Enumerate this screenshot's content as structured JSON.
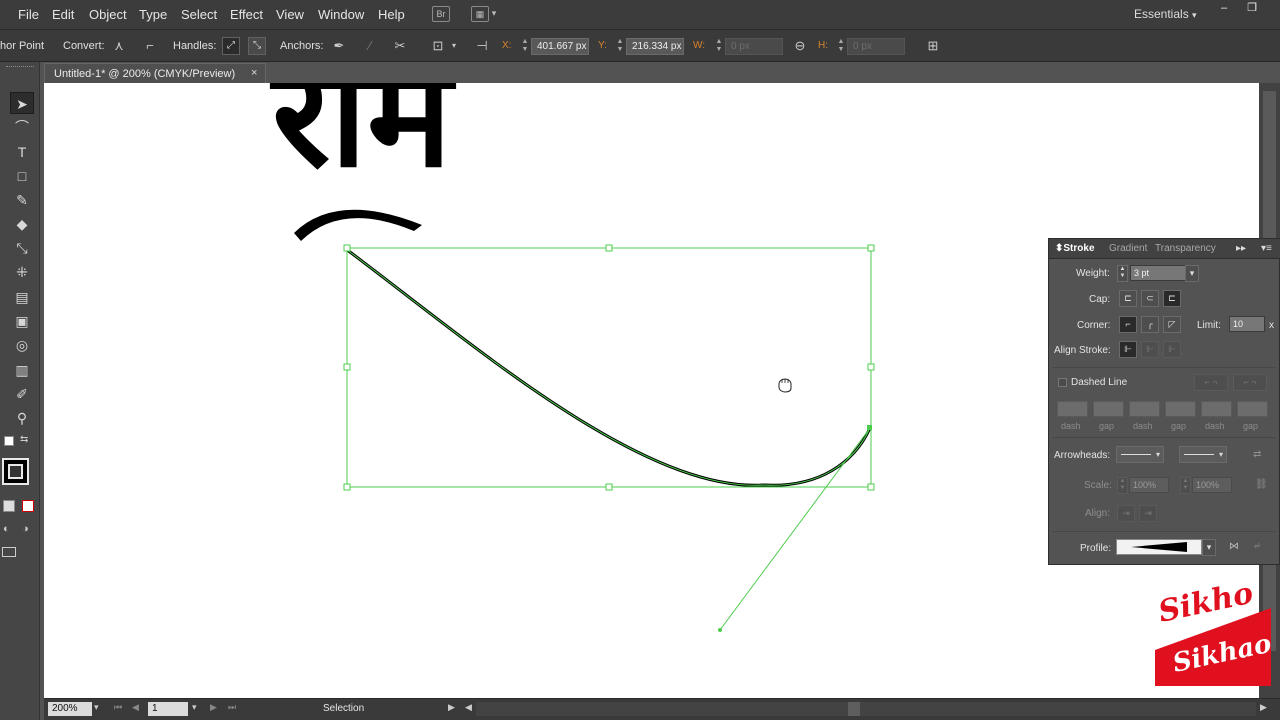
{
  "menubar": {
    "items": [
      "File",
      "Edit",
      "Object",
      "Type",
      "Select",
      "Effect",
      "View",
      "Window",
      "Help"
    ],
    "bridge_icon": "Br",
    "arrange_icon": "arrange-documents-icon",
    "workspace": "Essentials",
    "window_controls": [
      "–",
      "❐"
    ]
  },
  "controlbar": {
    "tool_name": "hor Point",
    "convert_label": "Convert:",
    "handles_label": "Handles:",
    "anchors_label": "Anchors:",
    "x_label": "X:",
    "x_value": "401.667 px",
    "y_label": "Y:",
    "y_value": "216.334 px",
    "w_label": "W:",
    "w_value": "0 px",
    "h_label": "H:",
    "h_value": "0 px"
  },
  "doc_tab": {
    "title": "Untitled-1* @ 200% (CMYK/Preview)",
    "close": "×"
  },
  "artwork": {
    "text": "राम",
    "text_color": "#000000",
    "selection_color": "#4ccc4c"
  },
  "statusbar": {
    "zoom": "200%",
    "page": "1",
    "mode": "Selection"
  },
  "stroke_panel": {
    "tabs": [
      "Stroke",
      "Gradient",
      "Transparency"
    ],
    "weight_label": "Weight:",
    "weight_value": "3 pt",
    "cap_label": "Cap:",
    "corner_label": "Corner:",
    "limit_label": "Limit:",
    "limit_value": "10",
    "limit_unit": "x",
    "align_label": "Align Stroke:",
    "dashed_label": "Dashed Line",
    "dash_labels": [
      "dash",
      "gap",
      "dash",
      "gap",
      "dash",
      "gap"
    ],
    "arrowheads_label": "Arrowheads:",
    "scale_label": "Scale:",
    "scale_value_1": "100%",
    "scale_value_2": "100%",
    "align_arrow_label": "Align:",
    "profile_label": "Profile:"
  },
  "logo": {
    "line1": "Sikho",
    "line2": "Sikhao",
    "color": "#e0101e"
  }
}
